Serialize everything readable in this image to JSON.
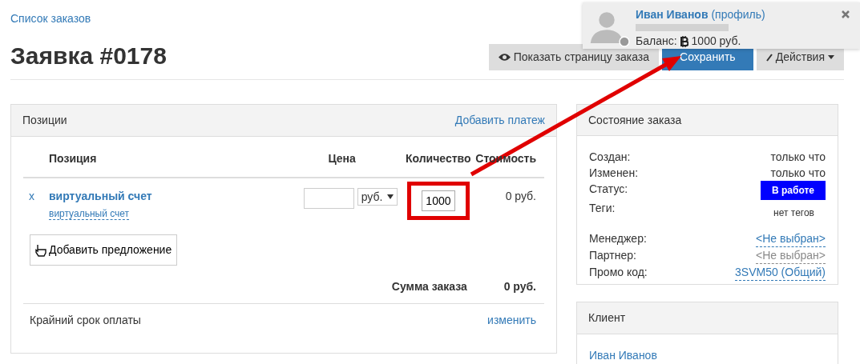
{
  "breadcrumb": "Список заказов",
  "title": "Заявка #0178",
  "actions": [
    {
      "label": "Показать страницу заказа",
      "kind": "view"
    },
    {
      "label": "Сохранить",
      "kind": "primary"
    },
    {
      "label": "Действия",
      "kind": "dropdown"
    }
  ],
  "positions": {
    "title": "Позиции",
    "add_payment": "Добавить платеж",
    "columns": [
      "Позиция",
      "Цена",
      "Количество",
      "Стоимость"
    ],
    "rows": [
      {
        "remove": "x",
        "name": "виртуальный счет",
        "subname": "виртуальный счет",
        "currency": "руб.",
        "quantity": "1000",
        "cost": "0 руб.",
        "highlighted": true
      }
    ],
    "add_offer": "Добавить предложение",
    "total_label": "Сумма заказа",
    "total": "0 руб.",
    "deadline_label": "Крайний срок оплаты",
    "deadline_action": "изменить"
  },
  "order_state": {
    "title": "Состояние заказа",
    "fields": [
      {
        "label": "Создан:",
        "value": "только что",
        "kind": "text"
      },
      {
        "label": "Изменен:",
        "value": "только что",
        "kind": "text"
      },
      {
        "label": "Статус:",
        "value": "В работе",
        "kind": "status"
      },
      {
        "label": "Теги:",
        "value": "нет тегов",
        "kind": "small"
      },
      {
        "label": "Менеджер:",
        "value": "<Не выбран>",
        "kind": "link",
        "disabled": false
      },
      {
        "label": "Партнер:",
        "value": "<Не выбран>",
        "kind": "link",
        "disabled": true
      },
      {
        "label": "Промо код:",
        "value": "3SVM50 (Общий)",
        "kind": "link",
        "disabled": false
      }
    ]
  },
  "client": {
    "title": "Клиент",
    "name": "Иван Иванов"
  },
  "user_popup": {
    "name": "Иван Иванов",
    "profile_link": "(профиль)",
    "balance_label": "Баланс:",
    "balance": "1000 руб."
  }
}
